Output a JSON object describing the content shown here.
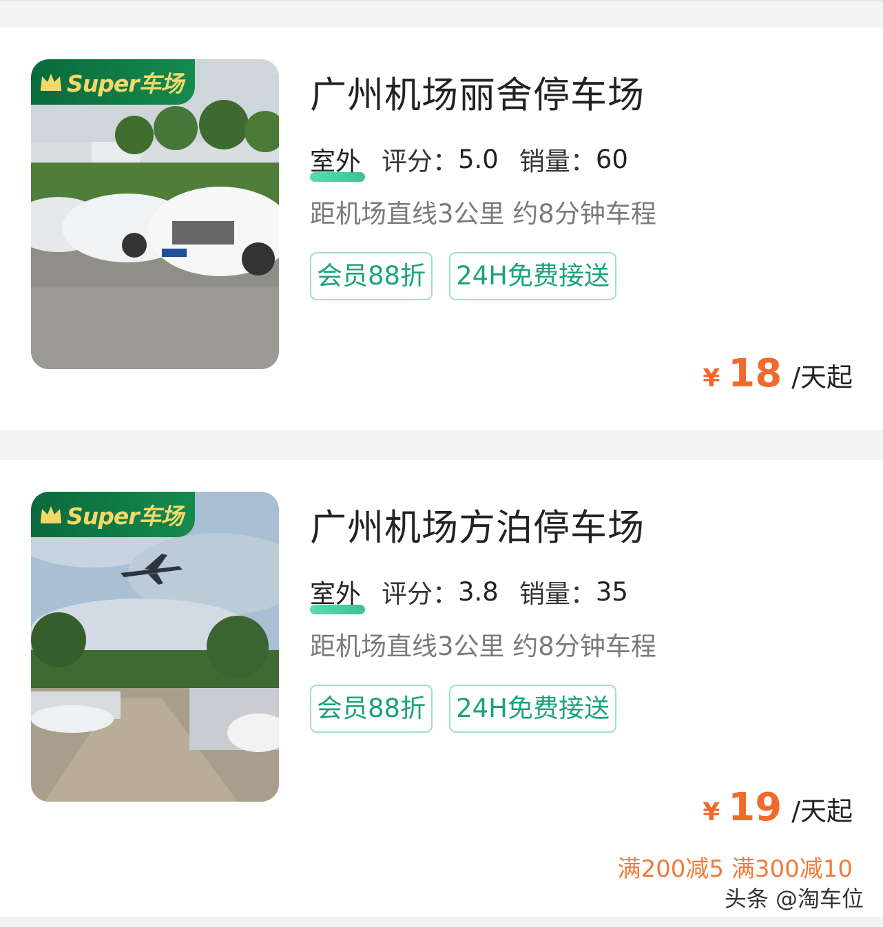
{
  "badge_label": "Super车场",
  "listings": [
    {
      "name": "广州机场丽舍停车场",
      "type": "室外",
      "rating_label": "评分：",
      "rating": "5.0",
      "sales_label": "销量：",
      "sales": "60",
      "distance": "距机场直线3公里 约8分钟车程",
      "tags": [
        "会员88折",
        "24H免费接送"
      ],
      "currency": "¥",
      "price": "18",
      "price_unit": "/天起"
    },
    {
      "name": "广州机场方泊停车场",
      "type": "室外",
      "rating_label": "评分：",
      "rating": "3.8",
      "sales_label": "销量：",
      "sales": "35",
      "distance": "距机场直线3公里 约8分钟车程",
      "tags": [
        "会员88折",
        "24H免费接送"
      ],
      "currency": "¥",
      "price": "19",
      "price_unit": "/天起",
      "promo": "满200减5 满300减10"
    }
  ],
  "watermark": "头条 @淘车位",
  "colors": {
    "accent_price": "#f06a2c",
    "tag_green": "#1aa37a",
    "badge_green": "#0a6a3d",
    "badge_text": "#f6d86a"
  }
}
